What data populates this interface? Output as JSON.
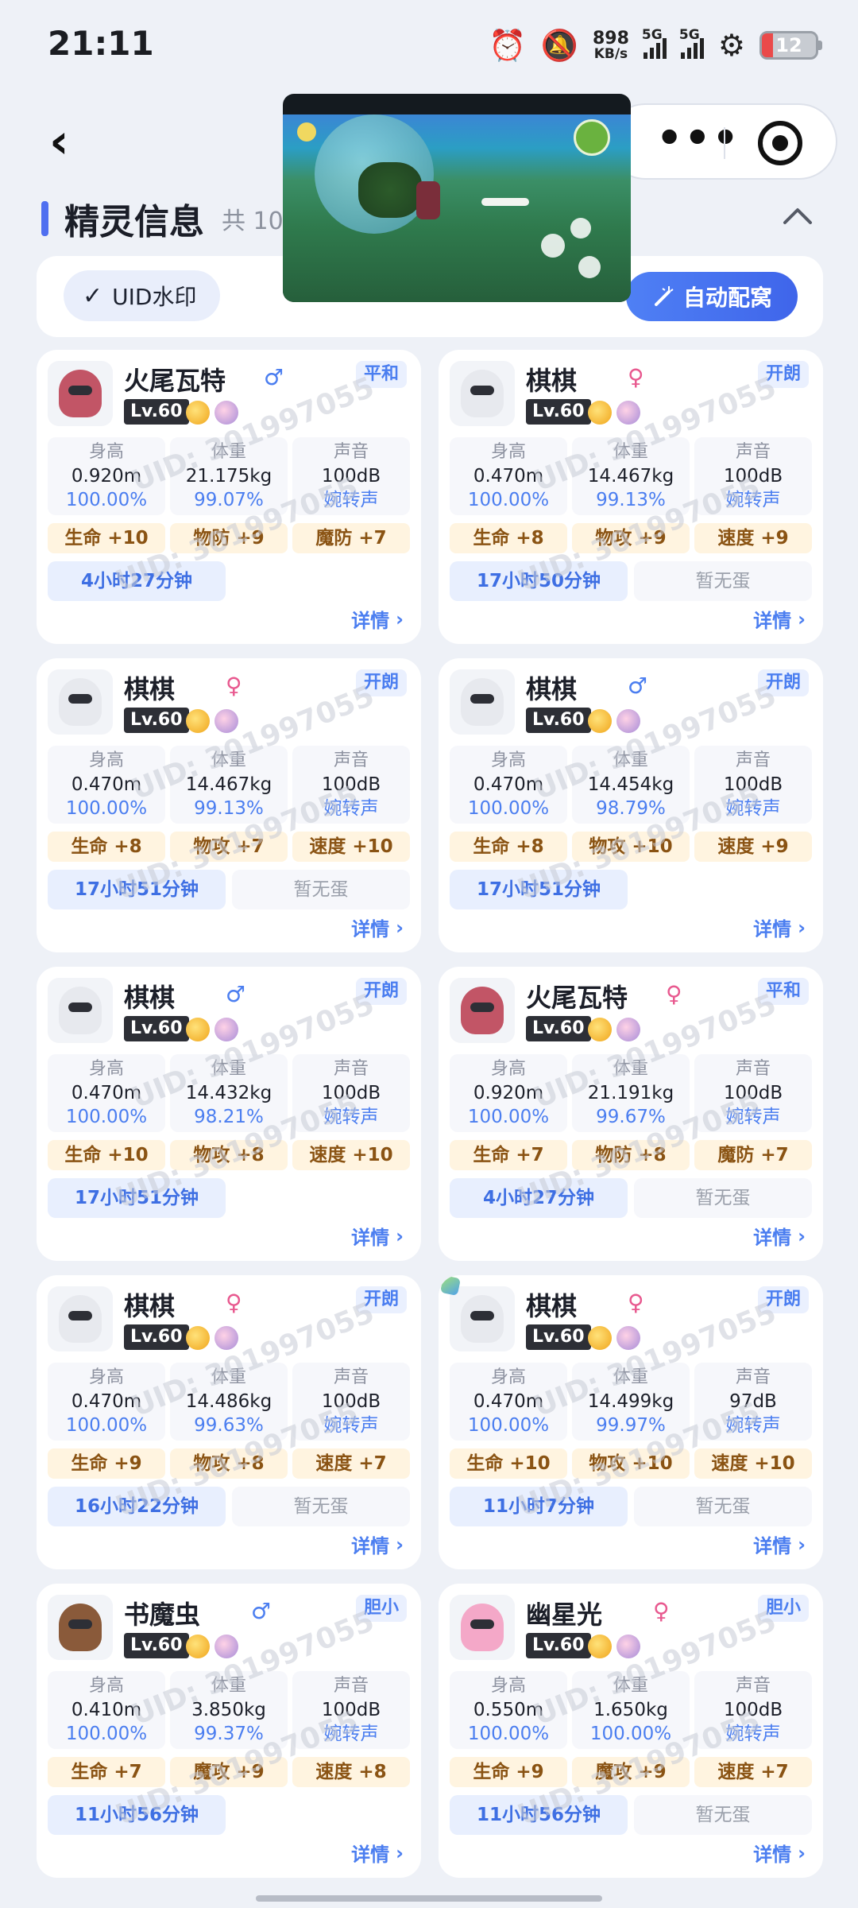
{
  "status_bar": {
    "time": "21:11",
    "net_speed_value": "898",
    "net_speed_unit": "KB/s",
    "signal1_label": "5G",
    "signal2_label": "5G",
    "battery": "12"
  },
  "header": {
    "section_title": "精灵信息",
    "count_text": "共 10",
    "more_glyph": "•••"
  },
  "toolbar": {
    "uid_toggle_label": "UID水印",
    "uid_check": "✓",
    "auto_button_label": "自动配窝"
  },
  "watermark": "UID: 301997055",
  "colors": {
    "accent": "#4b7ef0",
    "male": "#4b7ef0",
    "female": "#e8598f",
    "iv_bg": "#fff4e0"
  },
  "labels": {
    "height": "身高",
    "weight": "体重",
    "sound": "声音",
    "detail": "详情"
  },
  "cards": [
    {
      "name": "火尾瓦特",
      "gender": "♂",
      "gclass": "m",
      "level": "Lv.60",
      "nature": "平和",
      "avatar": "fire-tail-watt",
      "avatar_color": "#c25566",
      "height": "0.920m",
      "height_pct": "100.00%",
      "weight": "21.175kg",
      "weight_pct": "99.07%",
      "sound": "100dB",
      "sound_type": "婉转声",
      "ivs": [
        "生命 +10",
        "物防 +9",
        "魔防 +7"
      ],
      "timer": "4小时27分钟",
      "egg": ""
    },
    {
      "name": "棋棋",
      "gender": "♀",
      "gclass": "f",
      "level": "Lv.60",
      "nature": "开朗",
      "avatar": "qiqi",
      "avatar_color": "#e7e9ee",
      "height": "0.470m",
      "height_pct": "100.00%",
      "weight": "14.467kg",
      "weight_pct": "99.13%",
      "sound": "100dB",
      "sound_type": "婉转声",
      "ivs": [
        "生命 +8",
        "物攻 +9",
        "速度 +9"
      ],
      "timer": "17小时50分钟",
      "egg": "暂无蛋"
    },
    {
      "name": "棋棋",
      "gender": "♀",
      "gclass": "f",
      "level": "Lv.60",
      "nature": "开朗",
      "avatar": "qiqi",
      "avatar_color": "#e7e9ee",
      "height": "0.470m",
      "height_pct": "100.00%",
      "weight": "14.467kg",
      "weight_pct": "99.13%",
      "sound": "100dB",
      "sound_type": "婉转声",
      "ivs": [
        "生命 +8",
        "物攻 +7",
        "速度 +10"
      ],
      "timer": "17小时51分钟",
      "egg": "暂无蛋"
    },
    {
      "name": "棋棋",
      "gender": "♂",
      "gclass": "m",
      "level": "Lv.60",
      "nature": "开朗",
      "avatar": "qiqi",
      "avatar_color": "#e7e9ee",
      "height": "0.470m",
      "height_pct": "100.00%",
      "weight": "14.454kg",
      "weight_pct": "98.79%",
      "sound": "100dB",
      "sound_type": "婉转声",
      "ivs": [
        "生命 +8",
        "物攻 +10",
        "速度 +9"
      ],
      "timer": "17小时51分钟",
      "egg": ""
    },
    {
      "name": "棋棋",
      "gender": "♂",
      "gclass": "m",
      "level": "Lv.60",
      "nature": "开朗",
      "avatar": "qiqi",
      "avatar_color": "#e7e9ee",
      "height": "0.470m",
      "height_pct": "100.00%",
      "weight": "14.432kg",
      "weight_pct": "98.21%",
      "sound": "100dB",
      "sound_type": "婉转声",
      "ivs": [
        "生命 +10",
        "物攻 +8",
        "速度 +10"
      ],
      "timer": "17小时51分钟",
      "egg": ""
    },
    {
      "name": "火尾瓦特",
      "gender": "♀",
      "gclass": "f",
      "level": "Lv.60",
      "nature": "平和",
      "avatar": "fire-tail-watt",
      "avatar_color": "#c25566",
      "height": "0.920m",
      "height_pct": "100.00%",
      "weight": "21.191kg",
      "weight_pct": "99.67%",
      "sound": "100dB",
      "sound_type": "婉转声",
      "ivs": [
        "生命 +7",
        "物防 +8",
        "魔防 +7"
      ],
      "timer": "4小时27分钟",
      "egg": "暂无蛋"
    },
    {
      "name": "棋棋",
      "gender": "♀",
      "gclass": "f",
      "level": "Lv.60",
      "nature": "开朗",
      "avatar": "qiqi",
      "avatar_color": "#e7e9ee",
      "height": "0.470m",
      "height_pct": "100.00%",
      "weight": "14.486kg",
      "weight_pct": "99.63%",
      "sound": "100dB",
      "sound_type": "婉转声",
      "ivs": [
        "生命 +9",
        "物攻 +8",
        "速度 +7"
      ],
      "timer": "16小时22分钟",
      "egg": "暂无蛋"
    },
    {
      "name": "棋棋",
      "gender": "♀",
      "gclass": "f",
      "level": "Lv.60",
      "nature": "开朗",
      "avatar": "qiqi",
      "avatar_color": "#e7e9ee",
      "gem": true,
      "height": "0.470m",
      "height_pct": "100.00%",
      "weight": "14.499kg",
      "weight_pct": "99.97%",
      "sound": "97dB",
      "sound_type": "婉转声",
      "ivs": [
        "生命 +10",
        "物攻 +10",
        "速度 +10"
      ],
      "timer": "11小时7分钟",
      "egg": "暂无蛋"
    },
    {
      "name": "书魔虫",
      "gender": "♂",
      "gclass": "m",
      "level": "Lv.60",
      "nature": "胆小",
      "avatar": "book-worm",
      "avatar_color": "#8a5a3a",
      "height": "0.410m",
      "height_pct": "100.00%",
      "weight": "3.850kg",
      "weight_pct": "99.37%",
      "sound": "100dB",
      "sound_type": "婉转声",
      "ivs": [
        "生命 +7",
        "魔攻 +9",
        "速度 +8"
      ],
      "timer": "11小时56分钟",
      "egg": ""
    },
    {
      "name": "幽星光",
      "gender": "♀",
      "gclass": "f",
      "level": "Lv.60",
      "nature": "胆小",
      "avatar": "ghost-star",
      "avatar_color": "#f4a8c8",
      "height": "0.550m",
      "height_pct": "100.00%",
      "weight": "1.650kg",
      "weight_pct": "100.00%",
      "sound": "100dB",
      "sound_type": "婉转声",
      "ivs": [
        "生命 +9",
        "魔攻 +9",
        "速度 +7"
      ],
      "timer": "11小时56分钟",
      "egg": "暂无蛋"
    }
  ]
}
